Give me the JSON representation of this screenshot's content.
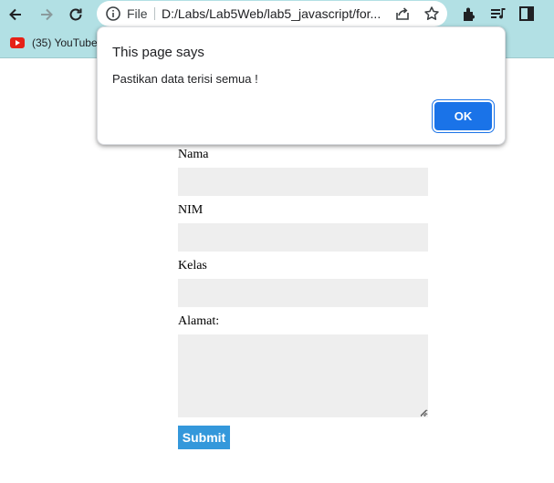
{
  "browser": {
    "address_scheme_label": "File",
    "address_url": "D:/Labs/Lab5Web/lab5_javascript/form_input.html",
    "bookmarks": [
      {
        "label": "(35) YouTube",
        "icon": "youtube-icon"
      }
    ],
    "colors": {
      "toolbar": "#b2e0e4",
      "omnibox": "#ffffff"
    }
  },
  "form": {
    "nama_label": "Nama",
    "nim_label": "NIM",
    "kelas_label": "Kelas",
    "alamat_label": "Alamat:",
    "submit_label": "Submit",
    "colors": {
      "field_bg": "#eeeeee",
      "submit_bg": "#3498db"
    }
  },
  "dialog": {
    "title": "This page says",
    "message": "Pastikan data terisi semua !",
    "ok_label": "OK",
    "colors": {
      "ok_bg": "#1a73e8"
    }
  }
}
